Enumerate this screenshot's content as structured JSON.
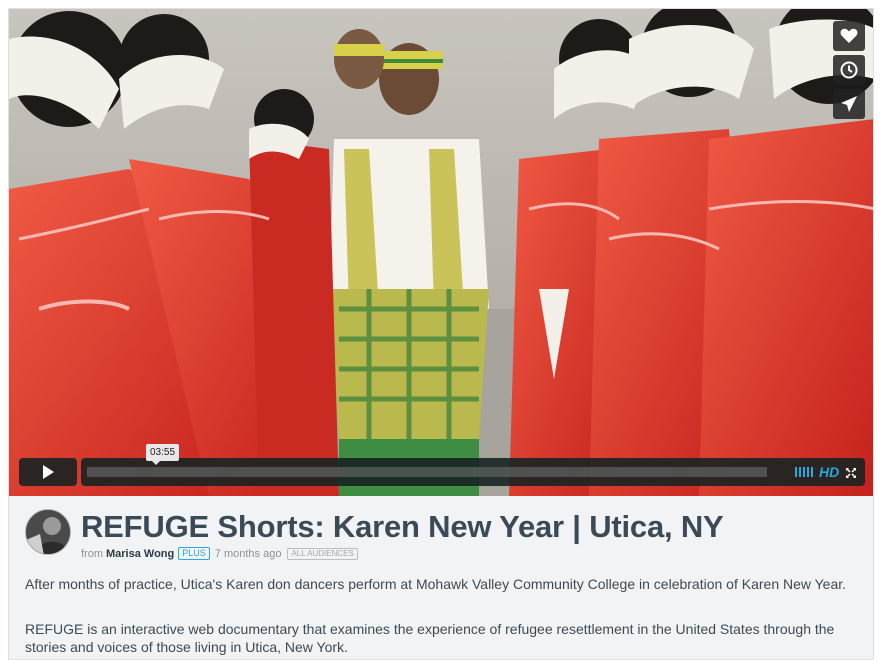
{
  "video": {
    "current_time": "03:55",
    "quality_label": "HD",
    "side_actions": [
      {
        "name": "like",
        "icon": "heart-icon"
      },
      {
        "name": "watch-later",
        "icon": "clock-icon"
      },
      {
        "name": "share",
        "icon": "paper-plane-icon"
      }
    ]
  },
  "info": {
    "title": "REFUGE Shorts: Karen New Year | Utica, NY",
    "from_label": "from",
    "author": "Marisa Wong",
    "plus_badge": "PLUS",
    "posted": "7 months ago",
    "audience_badge": "ALL AUDIENCES",
    "description_1": "After months of practice, Utica's Karen don dancers perform at Mohawk Valley Community College in celebration of Karen New Year.",
    "description_2": "REFUGE is an interactive web documentary that examines the experience of refugee resettlement in the United States through the stories and voices of those living in Utica, New York."
  },
  "colors": {
    "accent": "#2aa7dd",
    "title": "#3b4a57",
    "control_bg": "#172322",
    "dress_red": "#e2342a"
  }
}
